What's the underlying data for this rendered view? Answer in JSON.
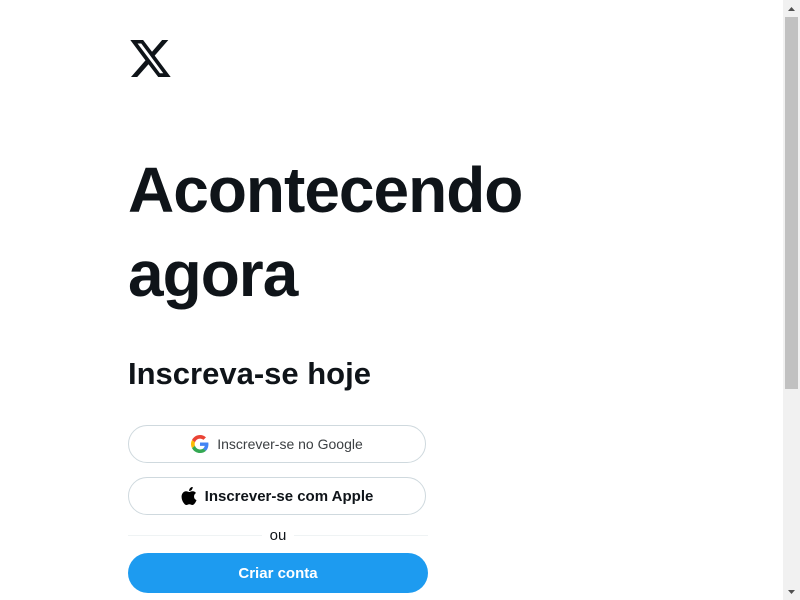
{
  "brand": {
    "logo_icon": "x-logo-icon"
  },
  "hero": {
    "headline_line1": "Acontecendo",
    "headline_line2": "agora"
  },
  "signup": {
    "title": "Inscreva-se hoje",
    "google_label": "Inscrever-se no Google",
    "apple_label": "Inscrever-se com Apple",
    "divider_text": "ou",
    "create_label": "Criar conta"
  },
  "colors": {
    "accent": "#1d9bf0",
    "text": "#0f1419",
    "border": "#cfd9de"
  },
  "scroll": {
    "position": 0.0
  }
}
